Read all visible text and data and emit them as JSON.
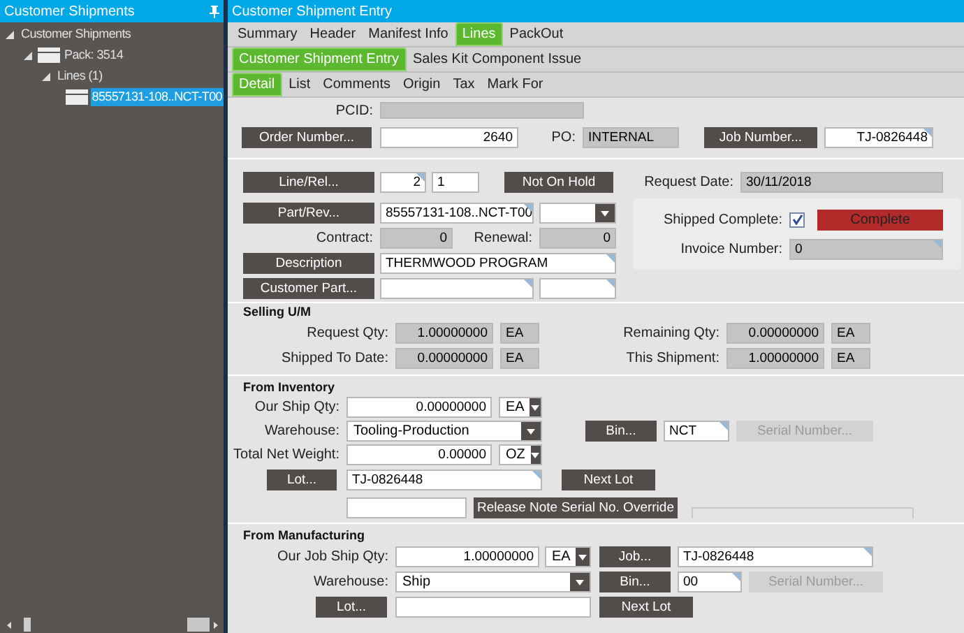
{
  "sidebar": {
    "title": "Customer Shipments",
    "tree": [
      {
        "label": "Customer Shipments",
        "expanded": true,
        "selected": false,
        "icon": false,
        "children": [
          {
            "label": "Pack: 3514",
            "expanded": true,
            "selected": false,
            "icon": true,
            "children": [
              {
                "label": "Lines (1)",
                "expanded": true,
                "selected": false,
                "icon": false,
                "children": [
                  {
                    "label": "85557131-108..NCT-T00",
                    "selected": true,
                    "icon": true
                  }
                ]
              }
            ]
          }
        ]
      }
    ]
  },
  "window": {
    "title": "Customer Shipment Entry"
  },
  "tabs": [
    {
      "label": "Summary",
      "selected": false
    },
    {
      "label": "Header",
      "selected": false
    },
    {
      "label": "Manifest Info",
      "selected": false
    },
    {
      "label": "Lines",
      "selected": true
    },
    {
      "label": "PackOut",
      "selected": false
    }
  ],
  "subtabs": [
    {
      "label": "Customer Shipment Entry",
      "selected": true
    },
    {
      "label": "Sales Kit Component Issue",
      "selected": false
    }
  ],
  "detail_tabs": [
    {
      "label": "Detail",
      "selected": true
    },
    {
      "label": "List",
      "selected": false
    },
    {
      "label": "Comments",
      "selected": false
    },
    {
      "label": "Origin",
      "selected": false
    },
    {
      "label": "Tax",
      "selected": false
    },
    {
      "label": "Mark For",
      "selected": false
    }
  ],
  "header": {
    "pcid_label": "PCID:",
    "order_button": "Order Number...",
    "order_number": "2640",
    "po_label": "PO:",
    "po": "INTERNAL",
    "job_button": "Job Number...",
    "job_number": "TJ-0826448"
  },
  "line": {
    "line_button": "Line/Rel...",
    "line": "2",
    "rel": "1",
    "hold_button": "Not On Hold",
    "request_date_label": "Request Date:",
    "request_date": "30/11/2018",
    "part_button": "Part/Rev...",
    "part": "85557131-108..NCT-T00",
    "contract_label": "Contract:",
    "contract": "0",
    "renewal_label": "Renewal:",
    "renewal": "0",
    "description_button": "Description",
    "description": "THERMWOOD PROGRAM",
    "customer_part_button": "Customer Part...",
    "shipped_complete_label": "Shipped Complete:",
    "shipped_complete": true,
    "status": "Complete",
    "invoice_label": "Invoice Number:",
    "invoice": "0"
  },
  "selling": {
    "title": "Selling U/M",
    "request_qty_label": "Request Qty:",
    "request_qty": "1.00000000",
    "request_um": "EA",
    "shipped_label": "Shipped To Date:",
    "shipped": "0.00000000",
    "shipped_um": "EA",
    "remaining_label": "Remaining Qty:",
    "remaining": "0.00000000",
    "remaining_um": "EA",
    "this_label": "This Shipment:",
    "this": "1.00000000",
    "this_um": "EA"
  },
  "inventory": {
    "title": "From Inventory",
    "qty_label": "Our Ship Qty:",
    "qty": "0.00000000",
    "um": "EA",
    "warehouse_label": "Warehouse:",
    "warehouse": "Tooling-Production",
    "bin_button": "Bin...",
    "bin": "NCT",
    "serial_button": "Serial Number...",
    "serial_disabled": true,
    "weight_label": "Total Net Weight:",
    "weight": "0.00000",
    "weight_um": "OZ",
    "lot_button": "Lot...",
    "lot": "TJ-0826448",
    "next_lot_button": "Next Lot",
    "override_button": "Release Note Serial No. Override"
  },
  "manufacturing": {
    "title": "From Manufacturing",
    "qty_label": "Our Job Ship Qty:",
    "qty": "1.00000000",
    "um": "EA",
    "job_button": "Job...",
    "job": "TJ-0826448",
    "warehouse_label": "Warehouse:",
    "warehouse": "Ship",
    "bin_button": "Bin...",
    "bin": "00",
    "serial_button": "Serial Number...",
    "serial_disabled": true,
    "lot_button": "Lot...",
    "next_lot_button": "Next Lot"
  }
}
